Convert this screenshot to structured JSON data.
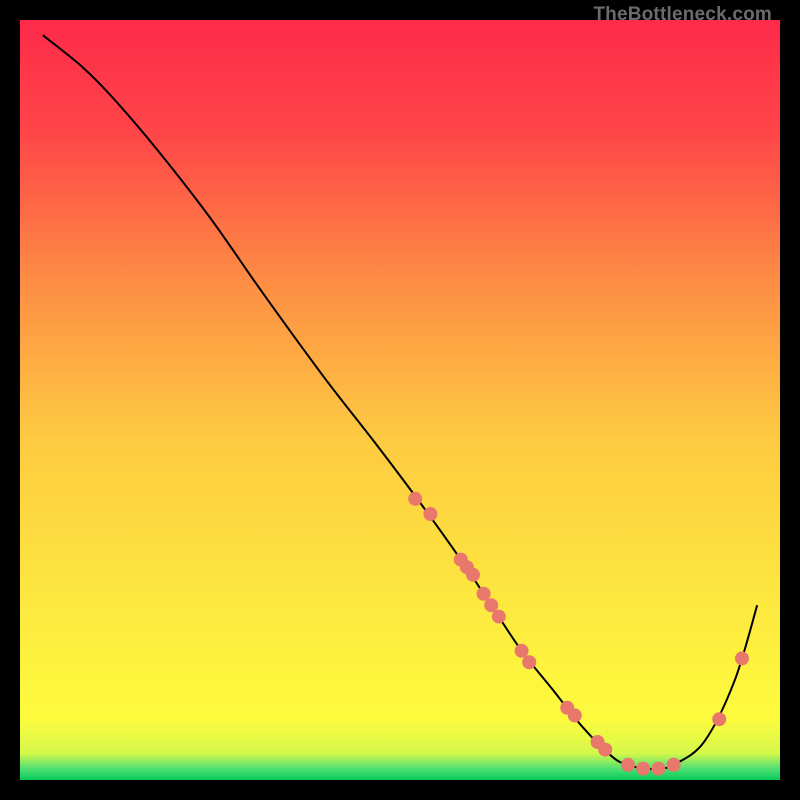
{
  "watermark": "TheBottleneck.com",
  "chart_data": {
    "type": "line",
    "title": "",
    "xlabel": "",
    "ylabel": "",
    "xlim": [
      0,
      100
    ],
    "ylim": [
      0,
      100
    ],
    "grid": false,
    "legend": false,
    "curve": {
      "name": "bottleneck-curve",
      "x": [
        3,
        8,
        12,
        18,
        25,
        32,
        40,
        47,
        53,
        58,
        62,
        66,
        70,
        74,
        78,
        80,
        82,
        84,
        86,
        90,
        94,
        97
      ],
      "y": [
        98,
        94,
        90,
        83,
        74,
        64,
        53,
        44,
        36,
        29,
        23,
        17,
        12,
        7,
        3,
        2,
        1.5,
        1.5,
        2,
        5,
        13,
        23
      ]
    },
    "markers": {
      "name": "highlight-points",
      "style": "circle",
      "color": "#e8776c",
      "x": [
        52,
        54,
        58,
        58.8,
        59.6,
        61,
        62,
        63,
        66,
        67,
        72,
        73,
        76,
        77,
        80,
        82,
        84,
        86,
        92,
        95
      ],
      "y": [
        37,
        35,
        29,
        28,
        27,
        24.5,
        23,
        21.5,
        17,
        15.5,
        9.5,
        8.5,
        5,
        4,
        2,
        1.5,
        1.5,
        2,
        8,
        16
      ]
    },
    "background_gradient": {
      "top": "#fe2a4a",
      "mid": "#fde63f",
      "bottom_band": "#08c859"
    }
  }
}
